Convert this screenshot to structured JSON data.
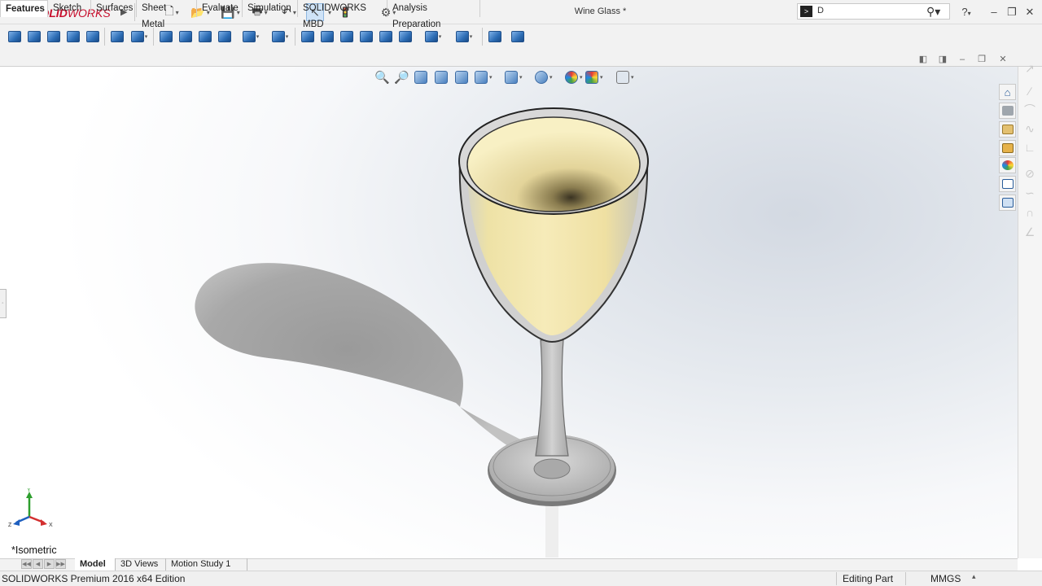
{
  "app": {
    "logo_ds": "DS",
    "logo_bold": "SOLID",
    "logo_thin": "WORKS"
  },
  "document": {
    "title": "Wine Glass *"
  },
  "search": {
    "value": "D",
    "placeholder": "",
    "cmd_glyph": ">"
  },
  "help_glyph": "?",
  "window_controls": {
    "minimize": "–",
    "restore": "❐",
    "close": "✕"
  },
  "quick_access": [
    {
      "name": "new-document-icon",
      "glyph": "🗋"
    },
    {
      "name": "open-icon",
      "glyph": "📂"
    },
    {
      "name": "save-icon",
      "glyph": "💾"
    },
    {
      "name": "print-icon",
      "glyph": "🖶"
    },
    {
      "name": "undo-icon",
      "glyph": "↶"
    },
    {
      "name": "select-icon",
      "glyph": "↖"
    },
    {
      "name": "rebuild-icon",
      "glyph": "🚦"
    },
    {
      "name": "options-icon",
      "glyph": "⚙"
    }
  ],
  "tabs": [
    "Features",
    "Sketch",
    "Surfaces",
    "Sheet Metal",
    "Evaluate",
    "Simulation",
    "SOLIDWORKS MBD",
    "Analysis Preparation"
  ],
  "active_tab": "Features",
  "viewport": {
    "view_orientation": "*Isometric"
  },
  "triad": {
    "x": "X",
    "y": "Y",
    "z": "Z"
  },
  "bottom_tabs": [
    "Model",
    "3D Views",
    "Motion Study 1"
  ],
  "active_bottom_tab": "Model",
  "status": {
    "edition": "SOLIDWORKS Premium 2016 x64 Edition",
    "mode": "Editing Part",
    "units": "MMGS"
  },
  "colors": {
    "brand": "#c8102e",
    "accent": "#2d6db5",
    "glass_liquid": "#efe3a8"
  }
}
